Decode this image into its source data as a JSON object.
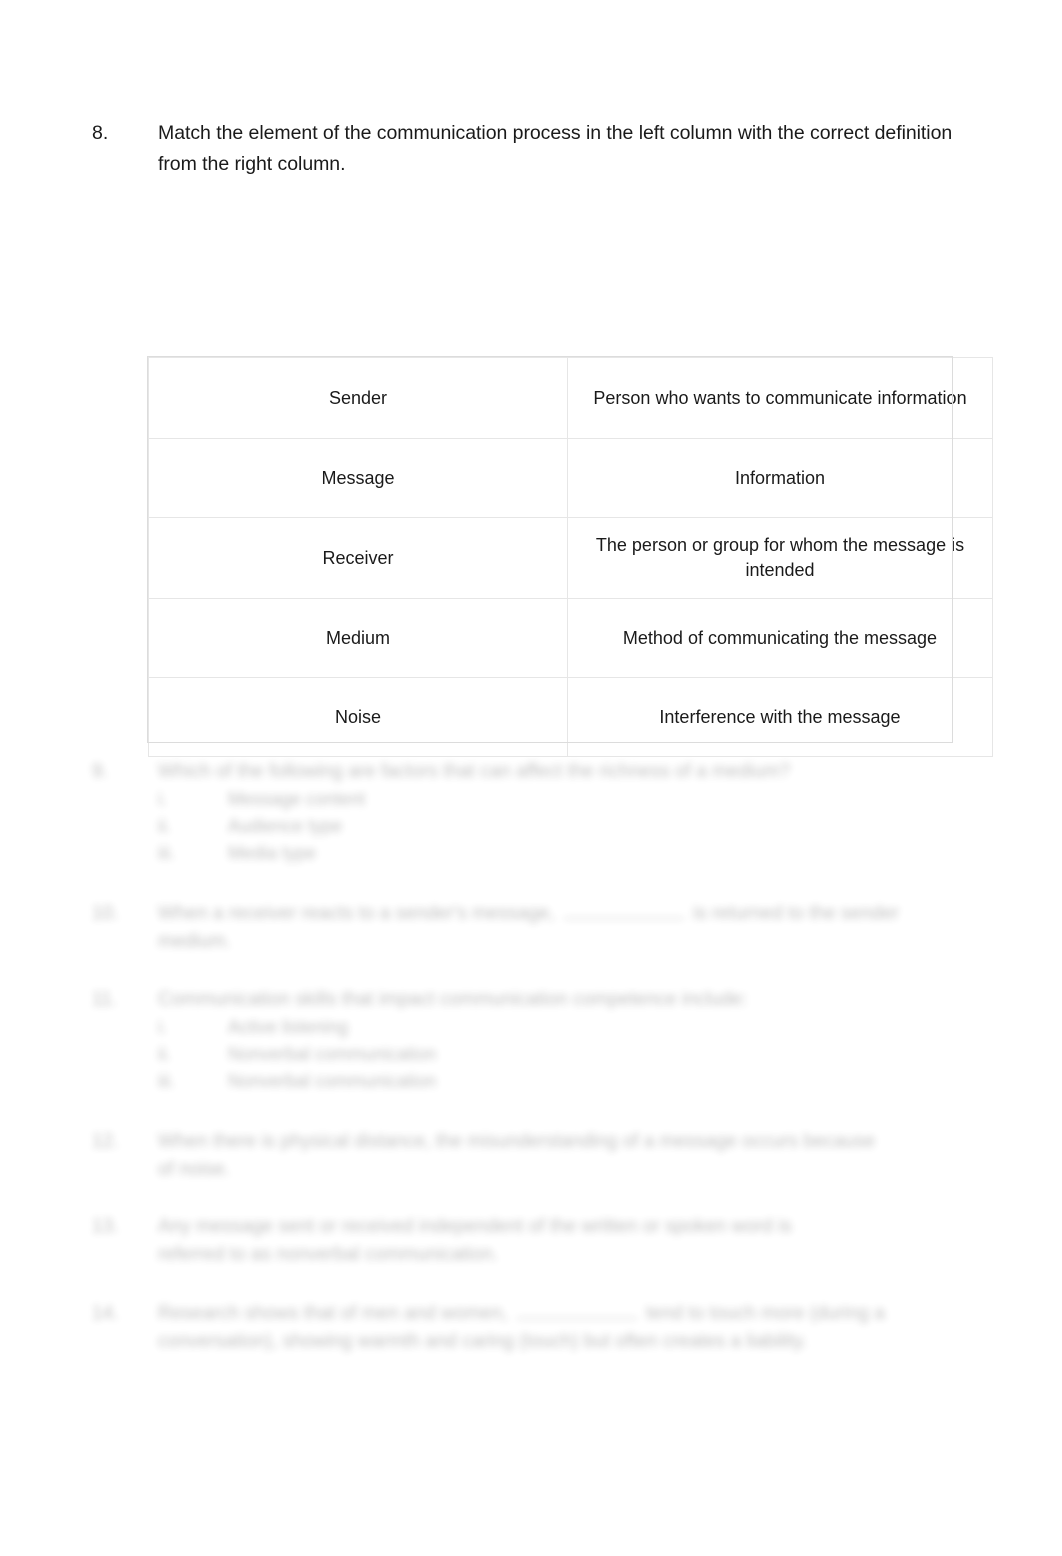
{
  "question_8": {
    "number": "8.",
    "prompt": "Match the element of the communication process in the left column with the correct definition from the right column."
  },
  "match_table": {
    "rows": [
      {
        "term": "Sender",
        "definition": "Person who wants to communicate information"
      },
      {
        "term": "Message",
        "definition": "Information"
      },
      {
        "term": "Receiver",
        "definition": "The person or group for whom the message is intended"
      },
      {
        "term": "Medium",
        "definition": "Method of communicating the message"
      },
      {
        "term": "Noise",
        "definition": "Interference with the message"
      }
    ]
  },
  "faded_questions": [
    {
      "number": "9.",
      "text": "Which of the following are factors that can affect the richness of a medium?",
      "subitems": [
        {
          "mark": "i.",
          "text": "Message content"
        },
        {
          "mark": "ii.",
          "text": "Audience type"
        },
        {
          "mark": "iii.",
          "text": "Media type"
        }
      ]
    },
    {
      "number": "10.",
      "text_before_blank": "When a receiver reacts to a sender's message,",
      "text_after_blank": "is returned to the sender medium."
    },
    {
      "number": "11.",
      "text": "Communication skills that impact communication competence include:",
      "subitems": [
        {
          "mark": "i.",
          "text": "Active listening"
        },
        {
          "mark": "ii.",
          "text": "Nonverbal communication"
        },
        {
          "mark": "iii.",
          "text": "Nonverbal communication"
        }
      ]
    },
    {
      "number": "12.",
      "text": "When there is physical distance, the misunderstanding of a message occurs because of noise."
    },
    {
      "number": "13.",
      "text": "Any message sent or received independent of the written or spoken word is referred to as nonverbal communication."
    },
    {
      "number": "14.",
      "text_before_blank": "Research shows that of men and women,",
      "text_after_blank": "tend to touch more (during a conversation), showing warmth and caring (touch) but often creates a liability."
    }
  ]
}
